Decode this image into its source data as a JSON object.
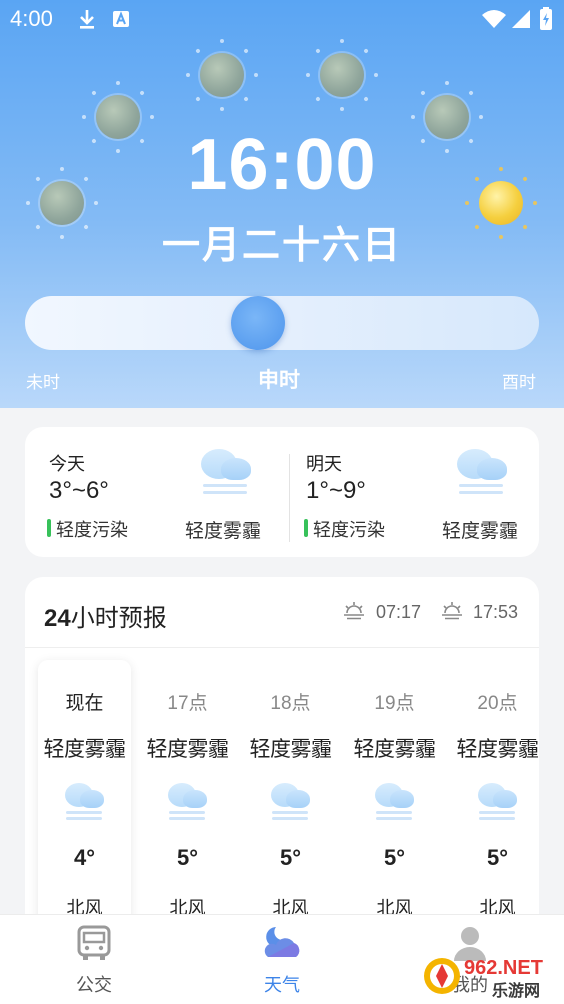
{
  "status_bar": {
    "time": "4:00",
    "icons": [
      "download-icon",
      "a-letter-icon",
      "wifi-icon",
      "signal-icon",
      "battery-icon"
    ]
  },
  "header": {
    "time": "16:00",
    "lunar_date": "一月二十六日",
    "slider": {
      "left_label": "未时",
      "center_label": "申时",
      "right_label": "酉时",
      "position": 0.5
    }
  },
  "days": [
    {
      "label": "今天",
      "range": "3°~6°",
      "pollution": "轻度污染",
      "condition": "轻度雾霾",
      "icon": "haze-icon"
    },
    {
      "label": "明天",
      "range": "1°~9°",
      "pollution": "轻度污染",
      "condition": "轻度雾霾",
      "icon": "haze-icon"
    }
  ],
  "forecast": {
    "title_bold": "24",
    "title_rest": "小时预报",
    "sunrise": "07:17",
    "sunset": "17:53",
    "hours": [
      {
        "label": "现在",
        "condition": "轻度雾霾",
        "temp": "4°",
        "wind": "北风"
      },
      {
        "label": "17点",
        "condition": "轻度雾霾",
        "temp": "5°",
        "wind": "北风"
      },
      {
        "label": "18点",
        "condition": "轻度雾霾",
        "temp": "5°",
        "wind": "北风"
      },
      {
        "label": "19点",
        "condition": "轻度雾霾",
        "temp": "5°",
        "wind": "北风"
      },
      {
        "label": "20点",
        "condition": "轻度雾霾",
        "temp": "5°",
        "wind": "北风"
      }
    ]
  },
  "nav": [
    {
      "label": "公交",
      "icon": "bus-icon",
      "active": false
    },
    {
      "label": "天气",
      "icon": "weather-icon",
      "active": true
    },
    {
      "label": "我的",
      "icon": "profile-icon",
      "active": false
    }
  ],
  "watermark": {
    "line1": "962.NET",
    "line2": "乐游网"
  },
  "colors": {
    "accent": "#3d84e8",
    "header_top": "#5aa5f3",
    "pollution_bar": "#37c15a"
  }
}
